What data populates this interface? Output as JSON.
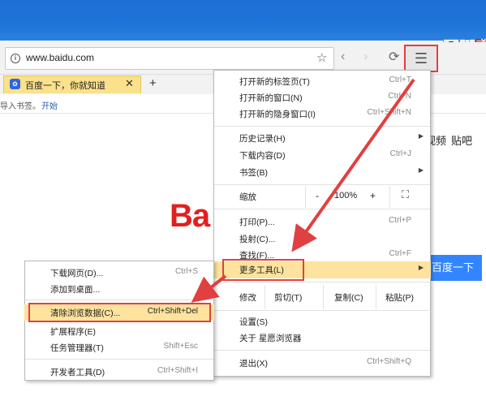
{
  "window": {
    "minimize_glyph": "‒",
    "maximize_glyph": "□",
    "close_glyph": "✕"
  },
  "toolbar": {
    "url": "www.baidu.com",
    "info_icon": "info-icon",
    "star_icon": "star-icon",
    "back_icon": "back-arrow-icon",
    "forward_icon": "forward-arrow-icon",
    "reload_icon": "reload-icon",
    "menu_icon": "hamburger-menu-icon"
  },
  "tabs": [
    {
      "title": "百度一下，你就知道",
      "active": true
    }
  ],
  "bookmarks_bar": {
    "text": "导入书签。",
    "link": "开始"
  },
  "page": {
    "nav_video": "视频",
    "nav_tieba": "贴吧",
    "logo": "Ba",
    "search_button": "百度一下"
  },
  "main_menu": {
    "items": [
      {
        "label": "打开新的标签页(T)",
        "accel": "Ctrl+T"
      },
      {
        "label": "打开新的窗口(N)",
        "accel": "Ctrl+N"
      },
      {
        "label": "打开新的隐身窗口(I)",
        "accel": "Ctrl+Shift+N"
      },
      {
        "label": "历史记录(H)",
        "accel": ""
      },
      {
        "label": "下载内容(D)",
        "accel": "Ctrl+J"
      },
      {
        "label": "书签(B)",
        "accel": ""
      },
      {
        "label": "打印(P)...",
        "accel": "Ctrl+P"
      },
      {
        "label": "投射(C)...",
        "accel": ""
      },
      {
        "label": "查找(F)...",
        "accel": "Ctrl+F"
      },
      {
        "label": "更多工具(L)",
        "accel": ""
      },
      {
        "label": "设置(S)",
        "accel": ""
      },
      {
        "label": "关于 星愿浏览器",
        "accel": ""
      },
      {
        "label": "退出(X)",
        "accel": "Ctrl+Shift+Q"
      }
    ],
    "zoom": {
      "label": "缩放",
      "minus": "-",
      "value": "100%",
      "plus": "+",
      "fullscreen_icon": "fullscreen-icon"
    },
    "edit": {
      "label": "修改",
      "cut": "剪切(T)",
      "copy": "复制(C)",
      "paste": "粘贴(P)"
    }
  },
  "sub_menu": {
    "items": [
      {
        "label": "下载网页(D)...",
        "accel": "Ctrl+S"
      },
      {
        "label": "添加到桌面...",
        "accel": ""
      },
      {
        "label": "清除浏览数据(C)...",
        "accel": "Ctrl+Shift+Del"
      },
      {
        "label": "扩展程序(E)",
        "accel": ""
      },
      {
        "label": "任务管理器(T)",
        "accel": "Shift+Esc"
      },
      {
        "label": "开发者工具(D)",
        "accel": "Ctrl+Shift+I"
      }
    ]
  },
  "colors": {
    "highlight": "#fde39d",
    "annotation_red": "#e04040",
    "baidu_red": "#e1201e",
    "baidu_blue": "#3385ff"
  }
}
